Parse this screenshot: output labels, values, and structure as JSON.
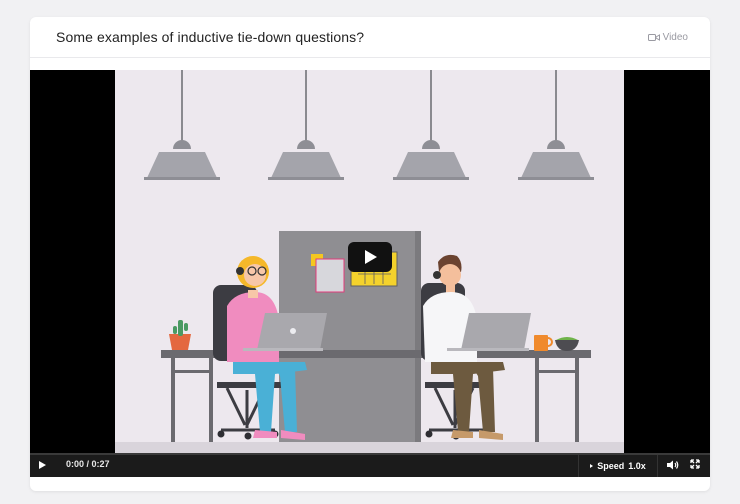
{
  "card": {
    "title": "Some examples of inductive tie-down questions?",
    "type_label": "Video",
    "type_icon": "video-camera-icon"
  },
  "player": {
    "current_time": "0:00 / 0:27",
    "speed_label": "Speed",
    "speed_value": "1.0x",
    "progress_fraction": 0,
    "play_icon": "play-icon",
    "volume_icon": "volume-icon",
    "fullscreen_icon": "fullscreen-icon"
  },
  "colors": {
    "scene_bg": "#ede8ee",
    "progress_accent": "#4b9fe1",
    "shirt_pink": "#f08cbf",
    "jeans": "#4ab0d6"
  }
}
